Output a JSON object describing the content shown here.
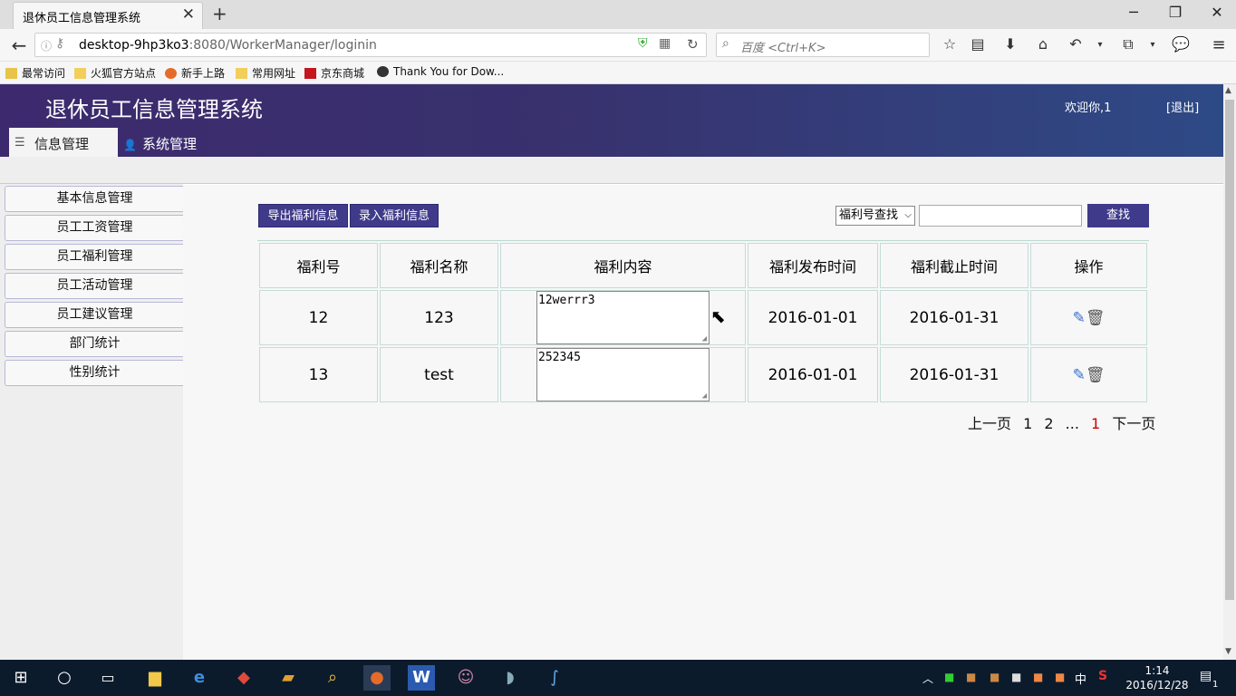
{
  "browser": {
    "tab_title": "退休员工信息管理系统",
    "new_tab": "+",
    "url_host": "desktop-9hp3ko3",
    "url_rest": ":8080/WorkerManager/loginin",
    "search_placeholder": "百度 <Ctrl+K>",
    "window_controls": [
      "minimize-icon",
      "restore-icon",
      "close-icon"
    ],
    "bookmarks": [
      "最常访问",
      "火狐官方站点",
      "新手上路",
      "常用网址",
      "京东商城",
      "Thank You for Dow..."
    ]
  },
  "app": {
    "title": "退休员工信息管理系统",
    "welcome": "欢迎你,1",
    "logout": "[退出]",
    "top_menu": [
      "信息管理",
      "系统管理"
    ],
    "sidebar": [
      "基本信息管理",
      "员工工资管理",
      "员工福利管理",
      "员工活动管理",
      "员工建议管理",
      "部门统计",
      "性别统计"
    ],
    "toolbar": {
      "export_label": "导出福利信息",
      "add_label": "录入福利信息"
    },
    "search": {
      "select_value": "福利号查找",
      "find_label": "查找"
    },
    "table": {
      "headers": [
        "福利号",
        "福利名称",
        "福利内容",
        "福利发布时间",
        "福利截止时间",
        "操作"
      ],
      "rows": [
        {
          "id": "12",
          "name": "123",
          "content": "12werrr3",
          "publish": "2016-01-01",
          "deadline": "2016-01-31"
        },
        {
          "id": "13",
          "name": "test",
          "content": "252345",
          "publish": "2016-01-01",
          "deadline": "2016-01-31"
        }
      ]
    },
    "pager": {
      "prev": "上一页",
      "p1": "1",
      "p2": "2",
      "ellipsis": "...",
      "current": "1",
      "next": "下一页"
    }
  },
  "taskbar": {
    "time": "1:14",
    "date": "2016/12/28",
    "ime": "中",
    "notify": "1"
  },
  "colors": {
    "header_start": "#3d2a6e",
    "header_end": "#2e4a86",
    "button": "#3f3a8a",
    "page_current": "#cc0000"
  }
}
